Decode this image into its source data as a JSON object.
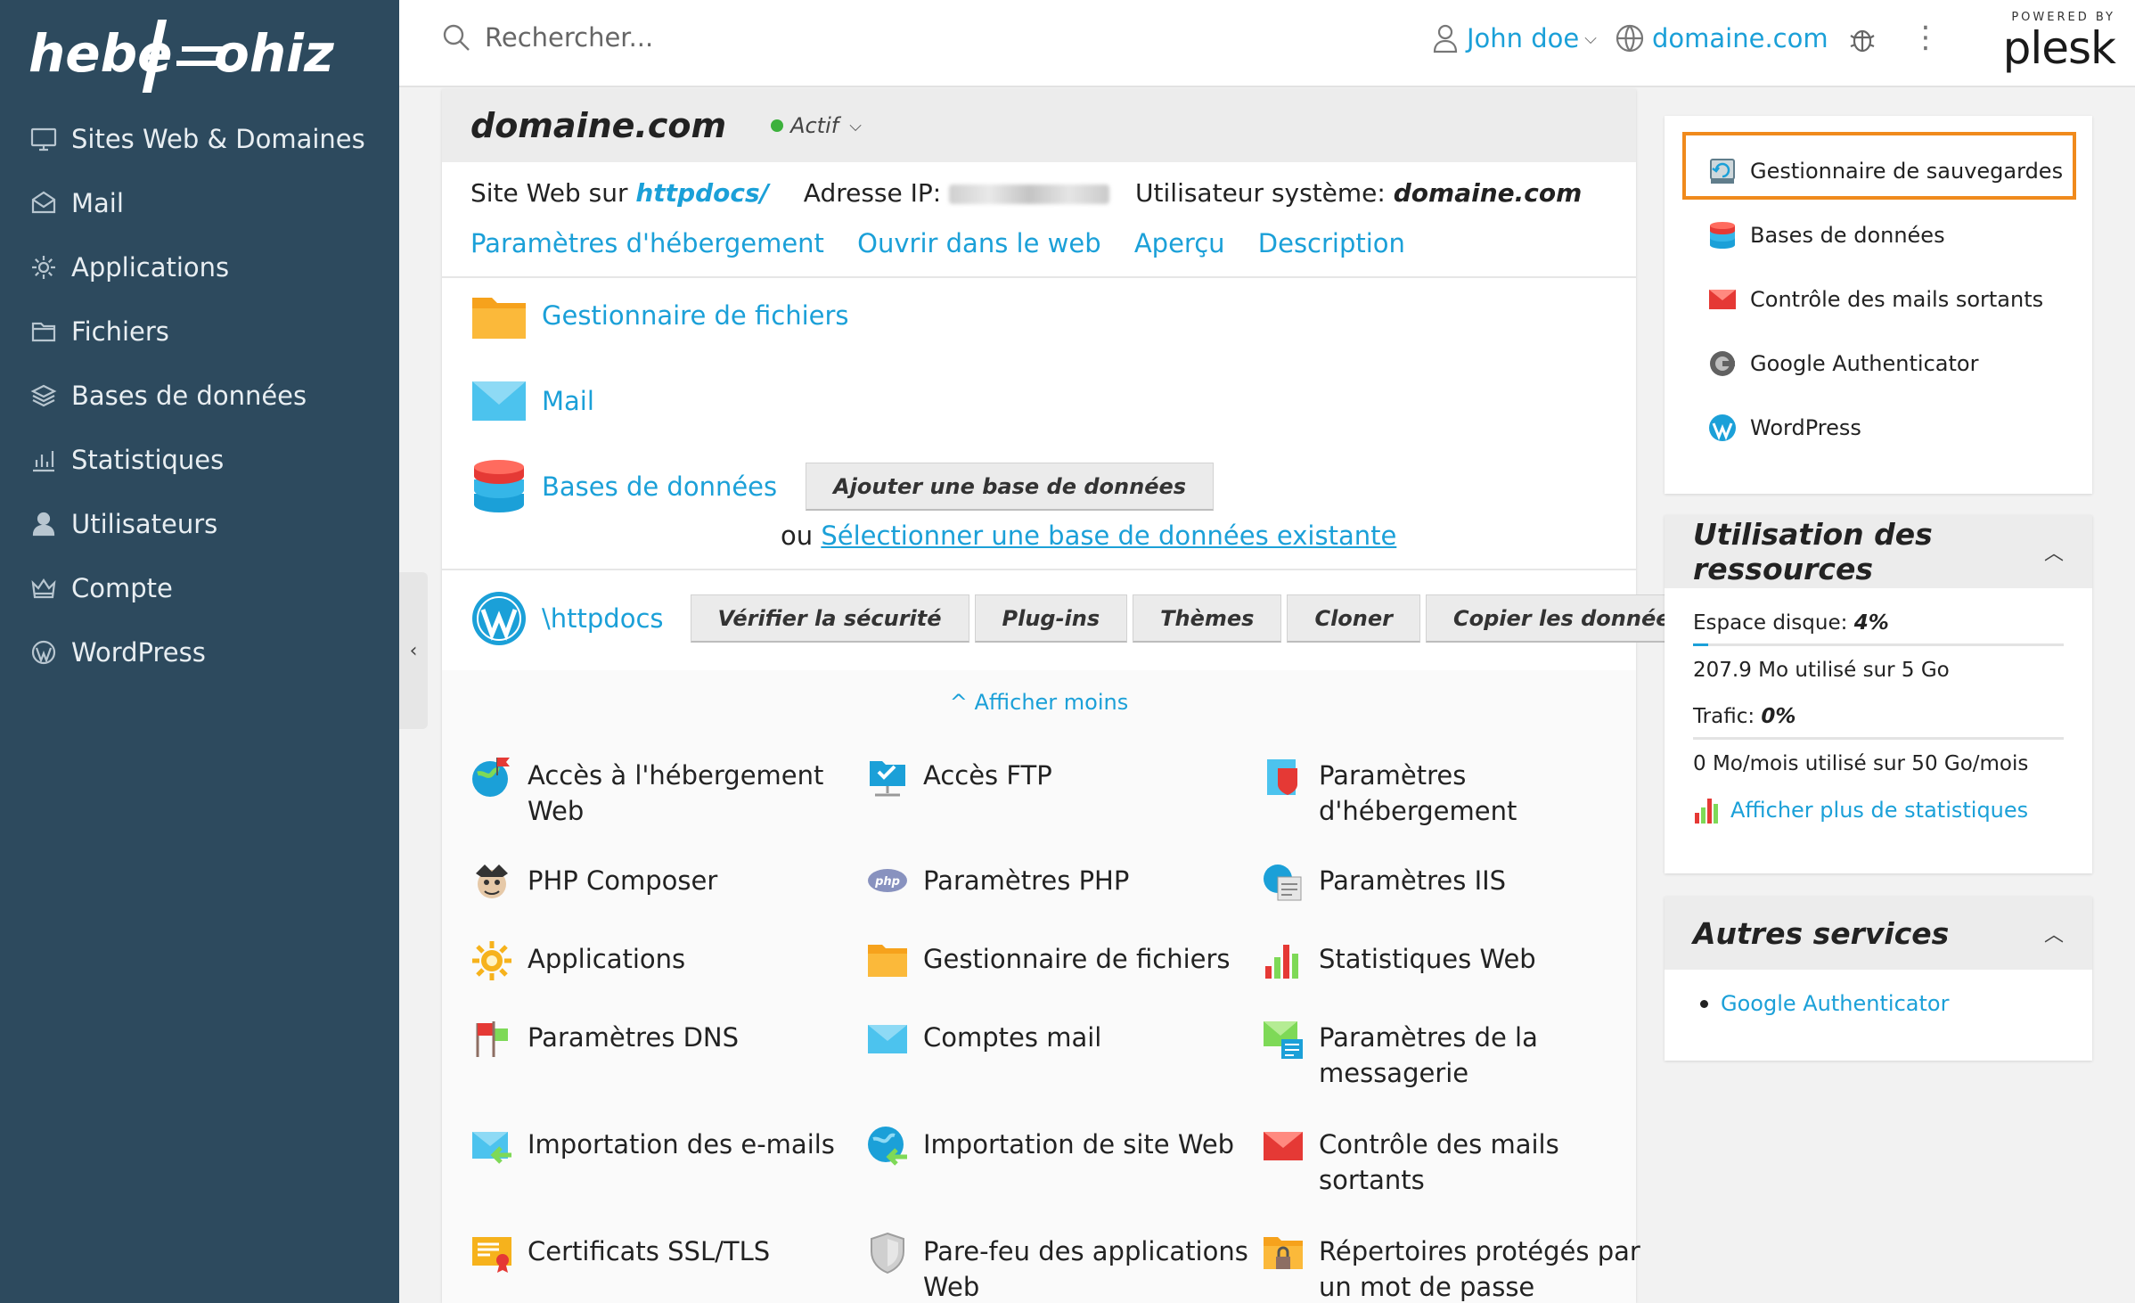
{
  "brand": {
    "logo_text": "hebergeur"
  },
  "sidebar": {
    "items": [
      {
        "label": "Sites Web & Domaines",
        "icon": "monitor-icon"
      },
      {
        "label": "Mail",
        "icon": "mail-icon"
      },
      {
        "label": "Applications",
        "icon": "gear-icon"
      },
      {
        "label": "Fichiers",
        "icon": "folder-icon"
      },
      {
        "label": "Bases de données",
        "icon": "layers-icon"
      },
      {
        "label": "Statistiques",
        "icon": "bar-chart-icon"
      },
      {
        "label": "Utilisateurs",
        "icon": "user-icon"
      },
      {
        "label": "Compte",
        "icon": "crown-icon"
      },
      {
        "label": "WordPress",
        "icon": "wordpress-icon"
      }
    ],
    "collapse_glyph": "‹"
  },
  "header": {
    "search_placeholder": "Rechercher...",
    "user": "John doe",
    "domain": "domaine.com",
    "more_glyph": "⋮",
    "powered_by": "POWERED BY",
    "plesk": "plesk"
  },
  "domain_panel": {
    "title": "domaine.com",
    "status": "Actif",
    "site_label": "Site Web sur ",
    "site_path": "httpdocs/",
    "ip_label": "Adresse IP:",
    "sysuser_label": "Utilisateur système: ",
    "sysuser": "domaine.com",
    "links": [
      "Paramètres d'hébergement",
      "Ouvrir dans le web",
      "Aperçu",
      "Description"
    ],
    "file_manager": "Gestionnaire de fichiers",
    "mail": "Mail",
    "databases": "Bases de données",
    "add_db": "Ajouter une base de données",
    "or": "ou ",
    "select_db": "Sélectionner une base de données existante",
    "wp_path": "\\httpdocs",
    "wp_buttons": [
      "Vérifier la sécurité",
      "Plug-ins",
      "Thèmes",
      "Cloner",
      "Copier les données"
    ],
    "show_less": "Afficher moins"
  },
  "tools": [
    {
      "label": "Accès à l'hébergement Web",
      "icon": "globe-flag-icon"
    },
    {
      "label": "Accès FTP",
      "icon": "ftp-folder-icon"
    },
    {
      "label": "Paramètres d'hébergement",
      "icon": "hosting-settings-icon"
    },
    {
      "label": "PHP Composer",
      "icon": "composer-icon"
    },
    {
      "label": "Paramètres PHP",
      "icon": "php-icon"
    },
    {
      "label": "Paramètres IIS",
      "icon": "iis-icon"
    },
    {
      "label": "Applications",
      "icon": "sun-gear-icon"
    },
    {
      "label": "Gestionnaire de fichiers",
      "icon": "folder-icon"
    },
    {
      "label": "Statistiques Web",
      "icon": "stats-icon"
    },
    {
      "label": "Paramètres DNS",
      "icon": "dns-flags-icon"
    },
    {
      "label": "Comptes mail",
      "icon": "mail-icon"
    },
    {
      "label": "Paramètres de la messagerie",
      "icon": "mail-settings-icon"
    },
    {
      "label": "Importation des e-mails",
      "icon": "mail-import-icon"
    },
    {
      "label": "Importation de site Web",
      "icon": "site-import-icon"
    },
    {
      "label": "Contrôle des mails sortants",
      "icon": "outgoing-mail-icon"
    },
    {
      "label": "Certificats SSL/TLS",
      "icon": "certificate-icon"
    },
    {
      "label": "Pare-feu des applications Web",
      "icon": "shield-icon"
    },
    {
      "label": "Répertoires protégés par un mot de passe",
      "icon": "locked-folder-icon"
    }
  ],
  "quick_links": [
    {
      "label": "Gestionnaire de sauvegardes",
      "icon": "backup-icon"
    },
    {
      "label": "Bases de données",
      "icon": "database-icon"
    },
    {
      "label": "Contrôle des mails sortants",
      "icon": "outgoing-mail-icon"
    },
    {
      "label": "Google Authenticator",
      "icon": "authenticator-icon"
    },
    {
      "label": "WordPress",
      "icon": "wordpress-icon"
    }
  ],
  "resources": {
    "title": "Utilisation des ressources",
    "disk_label": "Espace disque: ",
    "disk_value": "4%",
    "disk_percent": 4,
    "disk_detail": "207.9 Mo utilisé sur 5 Go",
    "traffic_label": "Trafic: ",
    "traffic_value": "0%",
    "traffic_percent": 0,
    "traffic_detail": "0 Mo/mois utilisé sur 50 Go/mois",
    "more_stats": "Afficher plus de statistiques"
  },
  "other_services": {
    "title": "Autres services",
    "items": [
      "Google Authenticator"
    ]
  },
  "colors": {
    "accent": "#1ba0d8",
    "sidebar": "#2d4a5e",
    "highlight": "#f08a1c",
    "status": "#3cb13c"
  }
}
